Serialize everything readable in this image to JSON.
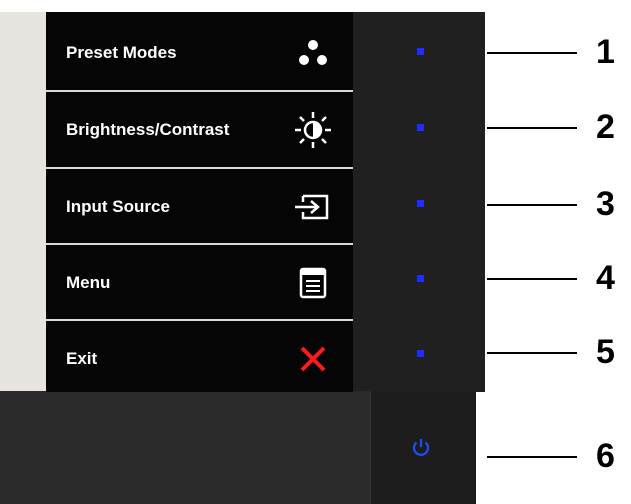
{
  "osd_menu": {
    "items": [
      {
        "label": "Preset Modes",
        "icon": "preset-modes-icon"
      },
      {
        "label": "Brightness/Contrast",
        "icon": "brightness-icon"
      },
      {
        "label": "Input Source",
        "icon": "input-source-icon"
      },
      {
        "label": "Menu",
        "icon": "menu-icon"
      },
      {
        "label": "Exit",
        "icon": "exit-icon"
      }
    ]
  },
  "buttons": {
    "led_color": "#1f2cff",
    "power_color": "#1f4cff",
    "exit_color": "#ff1a1a"
  },
  "callouts": [
    "1",
    "2",
    "3",
    "4",
    "5",
    "6"
  ]
}
